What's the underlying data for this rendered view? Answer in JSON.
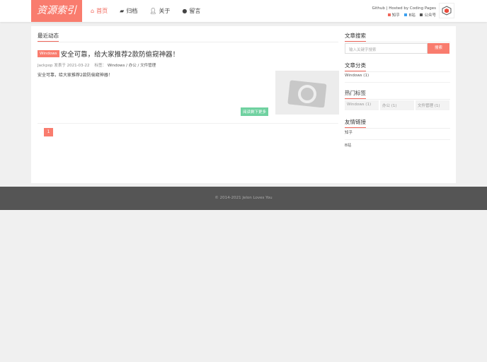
{
  "header": {
    "logo": "资源索引",
    "nav": [
      {
        "label": "首页",
        "icon": "home-icon"
      },
      {
        "label": "归档",
        "icon": "folder-icon"
      },
      {
        "label": "关于",
        "icon": "user-icon"
      },
      {
        "label": "留言",
        "icon": "comment-icon"
      }
    ],
    "right_line": "Github | Hosted by Coding Pages",
    "links": [
      {
        "label": "知乎",
        "color": "#f0665a"
      },
      {
        "label": "B站",
        "color": "#3aa0f0"
      },
      {
        "label": "公众号",
        "color": "#555555"
      }
    ]
  },
  "main": {
    "section_title": "最近动态",
    "post": {
      "tag": "Windows",
      "title": "安全可靠，给大家推荐2款防偷窥神器！",
      "author": "Jackpop",
      "posted_label": "发表于",
      "date": "2021-03-22",
      "tags_label": "标签：",
      "tags": "Windows / 办公 / 文件管理",
      "excerpt": "安全可靠，给大家推荐2款防偷窥神器！",
      "read_more": "阅读剩下更多"
    },
    "page": "1"
  },
  "sidebar": {
    "search_title": "文章搜索",
    "search_placeholder": "输入关键字搜索",
    "search_button": "搜索",
    "categories_title": "文章分类",
    "categories": [
      "Windows (1)"
    ],
    "tags_title": "热门标签",
    "tags": [
      "Windows (1)",
      "办公 (1)",
      "文件管理 (1)"
    ],
    "links_title": "友情链接",
    "links": [
      "知乎",
      "B站"
    ]
  },
  "footer": "© 2014-2021 Jelon Loves You"
}
